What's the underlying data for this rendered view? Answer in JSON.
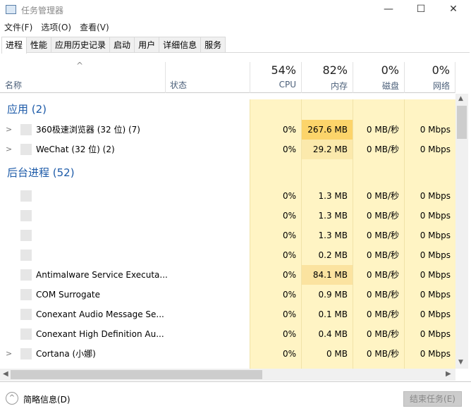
{
  "window": {
    "title": "任务管理器",
    "minimize": "—",
    "maximize": "☐",
    "close": "✕"
  },
  "menu": [
    "文件(F)",
    "选项(O)",
    "查看(V)"
  ],
  "tabs": [
    "进程",
    "性能",
    "应用历史记录",
    "启动",
    "用户",
    "详细信息",
    "服务"
  ],
  "header": {
    "name": "名称",
    "status": "状态",
    "cpu_pct": "54%",
    "cpu": "CPU",
    "mem_pct": "82%",
    "mem": "内存",
    "disk_pct": "0%",
    "disk": "磁盘",
    "net_pct": "0%",
    "net": "网络"
  },
  "groups": [
    {
      "label": "应用 (2)",
      "rows": [
        {
          "name": "360极速浏览器 (32 位) (7)",
          "expandable": true,
          "cpu": "0%",
          "mem": "267.6 MB",
          "disk": "0 MB/秒",
          "net": "0 Mbps",
          "heat": "#fcd46a"
        },
        {
          "name": "WeChat (32 位) (2)",
          "expandable": true,
          "cpu": "0%",
          "mem": "29.2 MB",
          "disk": "0 MB/秒",
          "net": "0 Mbps",
          "heat": "#fbe9ac"
        }
      ]
    },
    {
      "label": "后台进程 (52)",
      "rows": [
        {
          "name": "",
          "cpu": "0%",
          "mem": "1.3 MB",
          "disk": "0 MB/秒",
          "net": "0 Mbps"
        },
        {
          "name": "",
          "cpu": "0%",
          "mem": "1.3 MB",
          "disk": "0 MB/秒",
          "net": "0 Mbps"
        },
        {
          "name": "",
          "cpu": "0%",
          "mem": "1.3 MB",
          "disk": "0 MB/秒",
          "net": "0 Mbps"
        },
        {
          "name": "",
          "cpu": "0%",
          "mem": "0.2 MB",
          "disk": "0 MB/秒",
          "net": "0 Mbps"
        },
        {
          "name": "Antimalware Service Executa...",
          "cpu": "0%",
          "mem": "84.1 MB",
          "disk": "0 MB/秒",
          "net": "0 Mbps",
          "heat": "#fbe3a0"
        },
        {
          "name": "COM Surrogate",
          "cpu": "0%",
          "mem": "0.9 MB",
          "disk": "0 MB/秒",
          "net": "0 Mbps"
        },
        {
          "name": "Conexant Audio Message Se...",
          "cpu": "0%",
          "mem": "0.1 MB",
          "disk": "0 MB/秒",
          "net": "0 Mbps"
        },
        {
          "name": "Conexant High Definition Au...",
          "cpu": "0%",
          "mem": "0.4 MB",
          "disk": "0 MB/秒",
          "net": "0 Mbps"
        },
        {
          "name": "Cortana (小娜)",
          "expandable": true,
          "cpu": "0%",
          "mem": "0 MB",
          "disk": "0 MB/秒",
          "net": "0 Mbps"
        }
      ]
    }
  ],
  "footer": {
    "fewer_details": "简略信息(D)",
    "end_task": "结束任务(E)"
  }
}
